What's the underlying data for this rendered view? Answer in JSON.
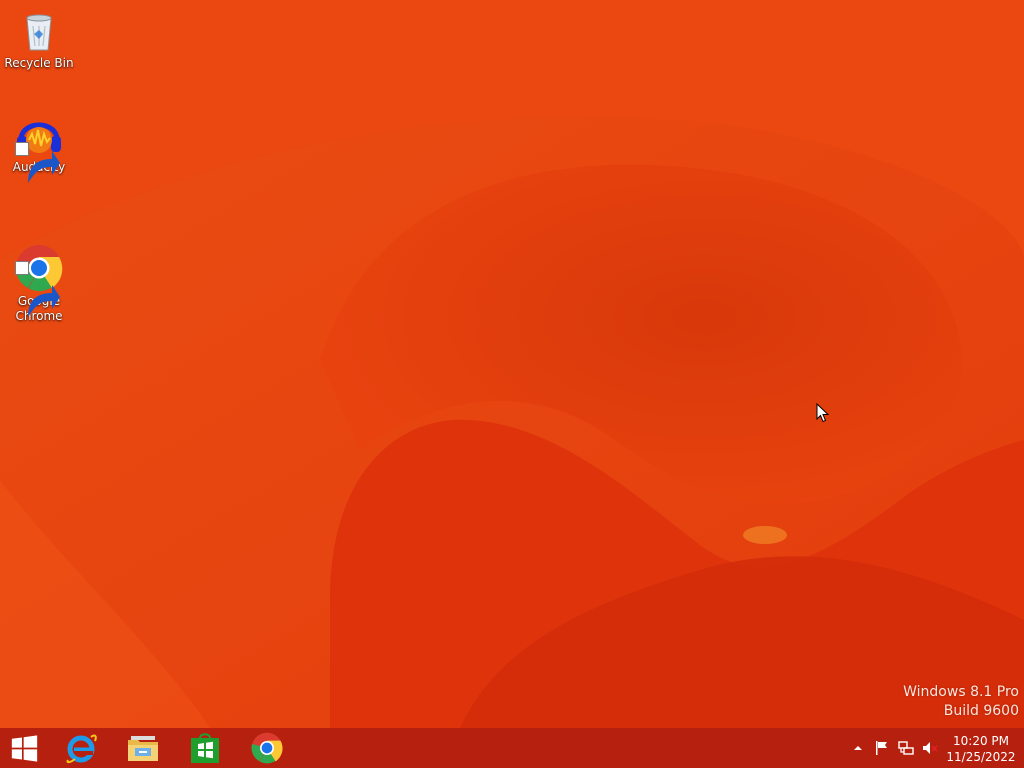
{
  "desktop": {
    "icons": [
      {
        "label": "Recycle Bin",
        "icon": "recycle-bin-icon"
      },
      {
        "label": "Audacity",
        "icon": "audacity-icon"
      },
      {
        "label": "Google\nChrome",
        "icon": "chrome-icon"
      }
    ],
    "watermark": {
      "line1": "Windows 8.1 Pro",
      "line2": "Build 9600"
    },
    "wallpaper_color": "#e8410f"
  },
  "taskbar": {
    "color": "#b6200f",
    "items": [
      {
        "name": "Start",
        "icon": "windows-logo-icon"
      },
      {
        "name": "Internet Explorer",
        "icon": "internet-explorer-icon"
      },
      {
        "name": "File Explorer",
        "icon": "file-explorer-icon"
      },
      {
        "name": "Store",
        "icon": "store-icon"
      },
      {
        "name": "Google Chrome",
        "icon": "chrome-icon"
      }
    ],
    "tray": {
      "icons": [
        "show-hidden-icons-chevron",
        "action-center-flag-icon",
        "network-icon",
        "volume-muted-icon"
      ],
      "time": "10:20 PM",
      "date": "11/25/2022"
    }
  }
}
